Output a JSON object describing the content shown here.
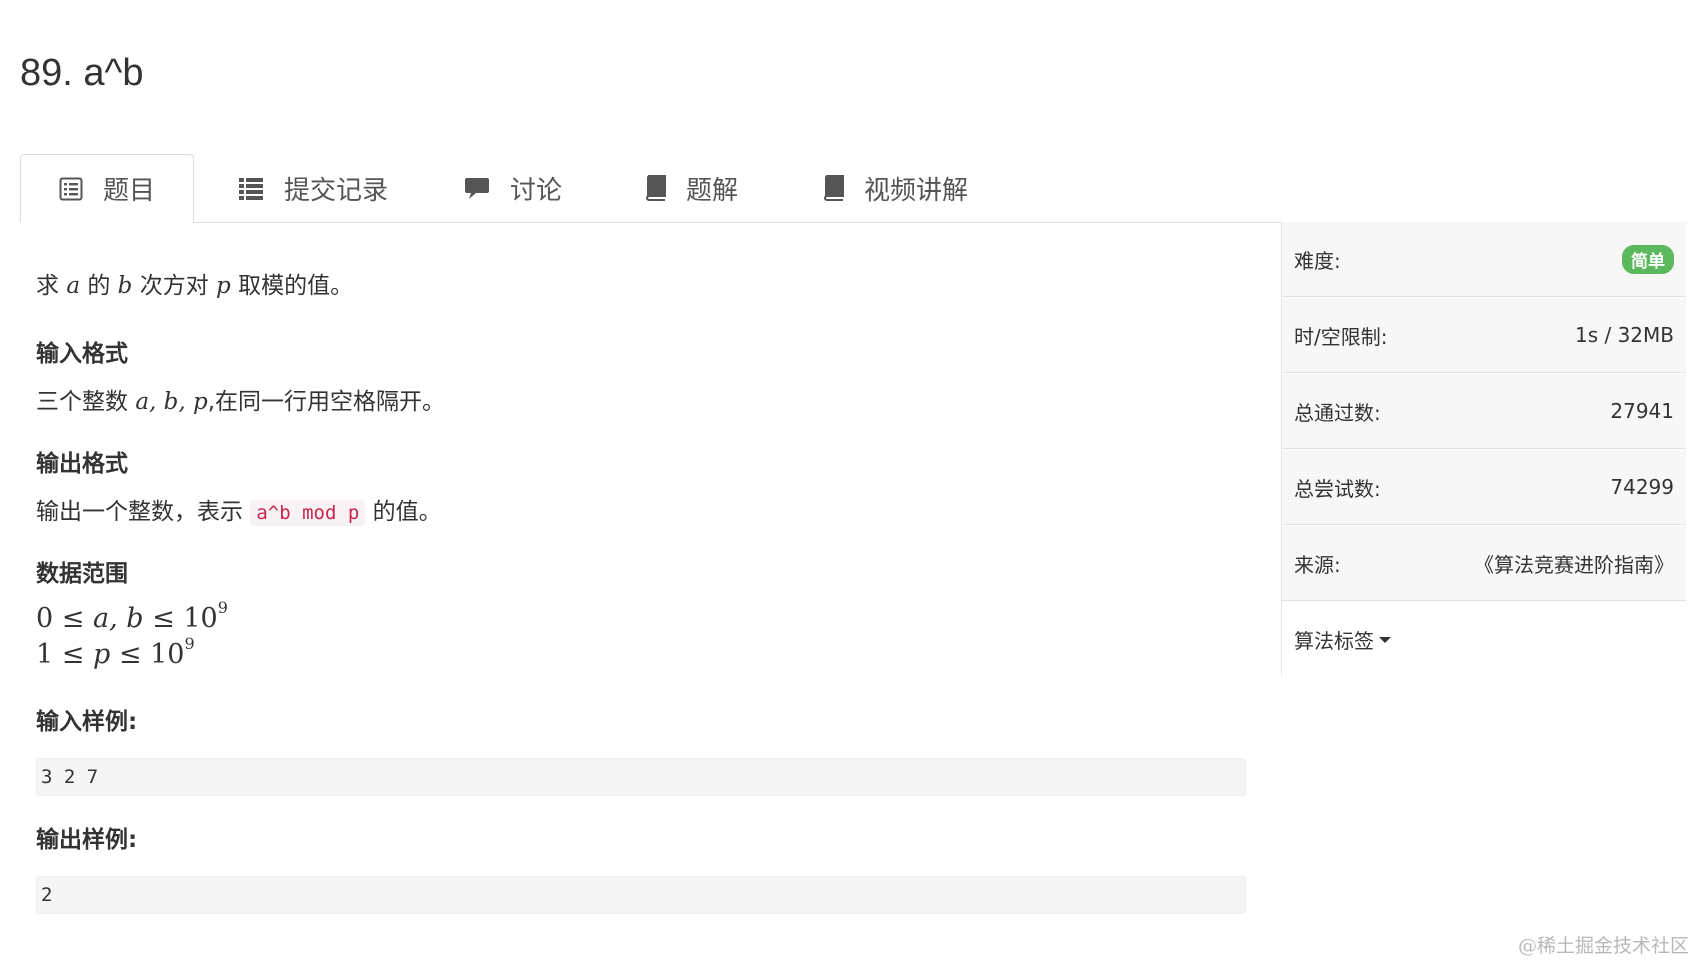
{
  "problem": {
    "title": "89. a^b"
  },
  "tabs": [
    {
      "label": "题目",
      "icon": "list-alt-icon"
    },
    {
      "label": "提交记录",
      "icon": "list-icon"
    },
    {
      "label": "讨论",
      "icon": "comment-icon"
    },
    {
      "label": "题解",
      "icon": "book-icon"
    },
    {
      "label": "视频讲解",
      "icon": "book-icon"
    }
  ],
  "statement": {
    "intro": {
      "w1": "求",
      "a": "a",
      "w2": "的",
      "b": "b",
      "w3": "次方对",
      "p": "p",
      "w4": "取模的值。"
    },
    "input_heading": "输入格式",
    "input_desc": {
      "w1": "三个整数",
      "vars": "a, b, p",
      "w2": ",在同一行用空格隔开。"
    },
    "output_heading": "输出格式",
    "output_desc": {
      "w1": "输出一个整数，表示",
      "code": "a^b mod p",
      "w2": "的值。"
    },
    "range_heading": "数据范围",
    "range1": {
      "lhs": "0",
      "le1": "≤",
      "var": "a, b",
      "le2": "≤",
      "base": "10",
      "exp": "9"
    },
    "range2": {
      "lhs": "1",
      "le1": "≤",
      "var": "p",
      "le2": "≤",
      "base": "10",
      "exp": "9"
    },
    "sample_input_heading": "输入样例:",
    "sample_input": "3 2 7",
    "sample_output_heading": "输出样例:",
    "sample_output": "2"
  },
  "sidebar": {
    "difficulty": {
      "label": "难度:",
      "value": "简单",
      "color": "#5cb85c"
    },
    "limits": {
      "label": "时/空限制:",
      "value": "1s / 32MB"
    },
    "passed": {
      "label": "总通过数:",
      "value": "27941"
    },
    "attempts": {
      "label": "总尝试数:",
      "value": "74299"
    },
    "source": {
      "label": "来源:",
      "value": "《算法竞赛进阶指南》"
    },
    "tags": {
      "label": "算法标签"
    }
  },
  "watermark": "@稀土掘金技术社区"
}
